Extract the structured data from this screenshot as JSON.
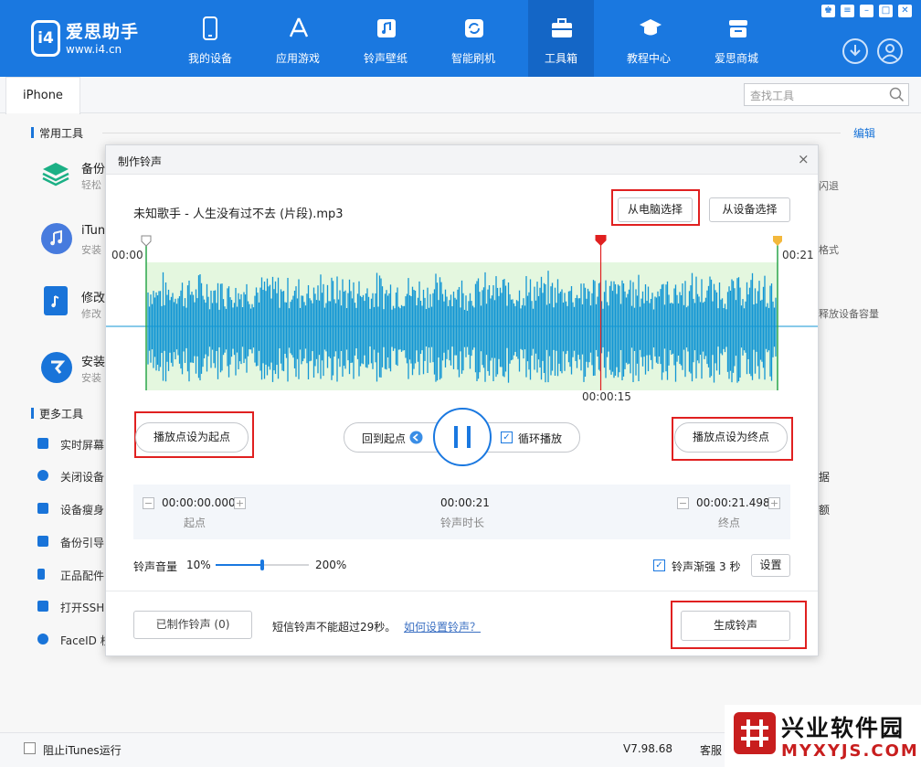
{
  "app": {
    "brand": "爱思助手",
    "site": "www.i4.cn",
    "logo": "i4"
  },
  "nav": [
    {
      "label": "我的设备",
      "icon": "phone-icon"
    },
    {
      "label": "应用游戏",
      "icon": "appstore-icon"
    },
    {
      "label": "铃声壁纸",
      "icon": "music-icon"
    },
    {
      "label": "智能刷机",
      "icon": "refresh-icon"
    },
    {
      "label": "工具箱",
      "icon": "toolbox-icon",
      "active": true
    },
    {
      "label": "教程中心",
      "icon": "graduation-cap-icon"
    },
    {
      "label": "爱思商城",
      "icon": "store-icon"
    }
  ],
  "window_buttons": [
    "shirt-icon",
    "menu-icon",
    "minimize-icon",
    "maximize-icon",
    "close-icon"
  ],
  "tab": {
    "label": "iPhone"
  },
  "search": {
    "placeholder": "查找工具"
  },
  "common": {
    "title": "常用工具",
    "edit": "编辑",
    "tools": [
      {
        "title": "备份",
        "sub": "轻松",
        "right": "闪退"
      },
      {
        "title": "iTun",
        "sub": "安装",
        "right": "格式"
      },
      {
        "title": "修改",
        "sub": "修改",
        "right": "释放设备容量"
      },
      {
        "title": "安装",
        "sub": "安装",
        "right": ""
      }
    ]
  },
  "more": {
    "title": "更多工具",
    "items": [
      "实时屏幕",
      "关闭设备",
      "设备瘦身",
      "备份引导",
      "正品配件",
      "打开SSH",
      "FaceID 校"
    ],
    "right": [
      "据",
      "额"
    ]
  },
  "footer": {
    "itunes": "阻止iTunes运行",
    "version": "V7.98.68",
    "service": "客服"
  },
  "dialog": {
    "title": "制作铃声",
    "close": "×",
    "file": "未知歌手 - 人生没有过不去 (片段).mp3",
    "from_pc": "从电脑选择",
    "from_device": "从设备选择",
    "wave_start": "00:00",
    "wave_end": "00:21",
    "playhead": "00:00:15",
    "playhead_fraction": 0.72,
    "set_start": "播放点设为起点",
    "back_start": "回到起点",
    "loop": "循环播放",
    "loop_checked": true,
    "set_end": "播放点设为终点",
    "start_time": "00:00:00.000",
    "start_label": "起点",
    "duration": "00:00:21",
    "duration_label": "铃声时长",
    "end_time": "00:00:21.498",
    "end_label": "终点",
    "volume_label": "铃声音量",
    "vol_min": "10%",
    "vol_max": "200%",
    "volume_fraction": 0.5,
    "fade_label": "铃声渐强",
    "fade_value": "3 秒",
    "fade_checked": true,
    "settings": "设置",
    "made": "已制作铃声 (0)",
    "sms_note": "短信铃声不能超过29秒。",
    "howto": "如何设置铃声？",
    "generate": "生成铃声"
  },
  "watermark": {
    "text": "兴业软件园",
    "url": "MYXYJS.COM",
    "colors": {
      "brand": "#c81e1e"
    }
  },
  "colors": {
    "primary": "#1a78e0",
    "wave": "#1296d4",
    "playhead": "#e02020",
    "end_marker": "#f3b83c",
    "highlight": "#e02020"
  }
}
